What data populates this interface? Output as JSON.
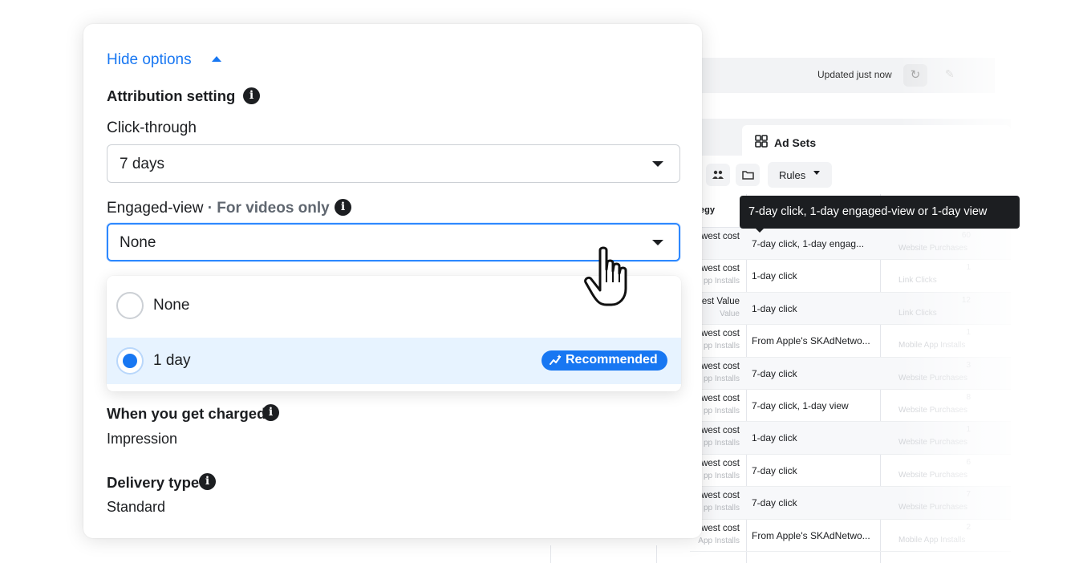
{
  "background": {
    "updated_text": "Updated just now",
    "ad_sets_tab": "Ad Sets",
    "rules_button": "Rules",
    "column_fragment": "egy",
    "rows": [
      {
        "strategy": "west cost",
        "strategy_sub": "",
        "attribution": "7-day click, 1-day engag..."
      },
      {
        "strategy": "west cost",
        "strategy_sub": "pp Installs",
        "attribution": "1-day click"
      },
      {
        "strategy": "est Value",
        "strategy_sub": "Value",
        "attribution": "1-day click"
      },
      {
        "strategy": "west cost",
        "strategy_sub": "pp Installs",
        "attribution": "From Apple's SKAdNetwo..."
      },
      {
        "strategy": "west cost",
        "strategy_sub": "pp Installs",
        "attribution": "7-day click"
      },
      {
        "strategy": "west cost",
        "strategy_sub": "pp Installs",
        "attribution": "7-day click, 1-day view"
      },
      {
        "strategy": "west cost",
        "strategy_sub": "pp Installs",
        "attribution": "1-day click"
      },
      {
        "strategy": "west cost",
        "strategy_sub": "pp Installs",
        "attribution": "7-day click"
      },
      {
        "strategy": "west cost",
        "strategy_sub": "pp Installs",
        "attribution": "7-day click"
      },
      {
        "strategy": "west cost",
        "strategy_sub": "App Installs",
        "attribution": "From Apple's SKAdNetwo..."
      }
    ],
    "faded_results": [
      "Website Purchases",
      "Link Clicks",
      "Link Clicks",
      "Mobile App Installs",
      "Website Purchases",
      "Website Purchases",
      "Website Purchases",
      "Website Purchases",
      "Website Purchases",
      "Mobile App Installs"
    ],
    "faded_numbers": [
      "60",
      "1",
      "12",
      "1",
      "3",
      "8",
      "1",
      "6",
      "7",
      "2"
    ],
    "tooltip": "7-day click, 1-day engaged-view or 1-day view"
  },
  "panel": {
    "hide_options": "Hide options",
    "attribution_title": "Attribution setting",
    "click_through_label": "Click-through",
    "click_through_value": "7 days",
    "engaged_view_label": "Engaged-view",
    "engaged_view_sub": "· For videos only",
    "engaged_view_value": "None",
    "options": [
      {
        "label": "None",
        "selected": false
      },
      {
        "label": "1 day",
        "selected": true
      }
    ],
    "recommended_badge": "Recommended",
    "charged_title": "When you get charged",
    "charged_value": "Impression",
    "delivery_title": "Delivery type",
    "delivery_value": "Standard",
    "info_glyph": "i"
  },
  "colors": {
    "accent": "#1877f2",
    "focus_border": "#2d88ff",
    "selected_bg": "#e7f3ff",
    "tooltip_bg": "#1c1e21",
    "text": "#1c1e21"
  },
  "icons": {
    "hide_options": "caret-up-icon",
    "info": "info-icon",
    "dropdown": "caret-down-icon",
    "refresh": "refresh-icon",
    "edit": "pencil-icon",
    "ad_sets": "grid-icon",
    "badge": "sparkle-chart-icon",
    "cursor": "hand-pointer-icon"
  }
}
